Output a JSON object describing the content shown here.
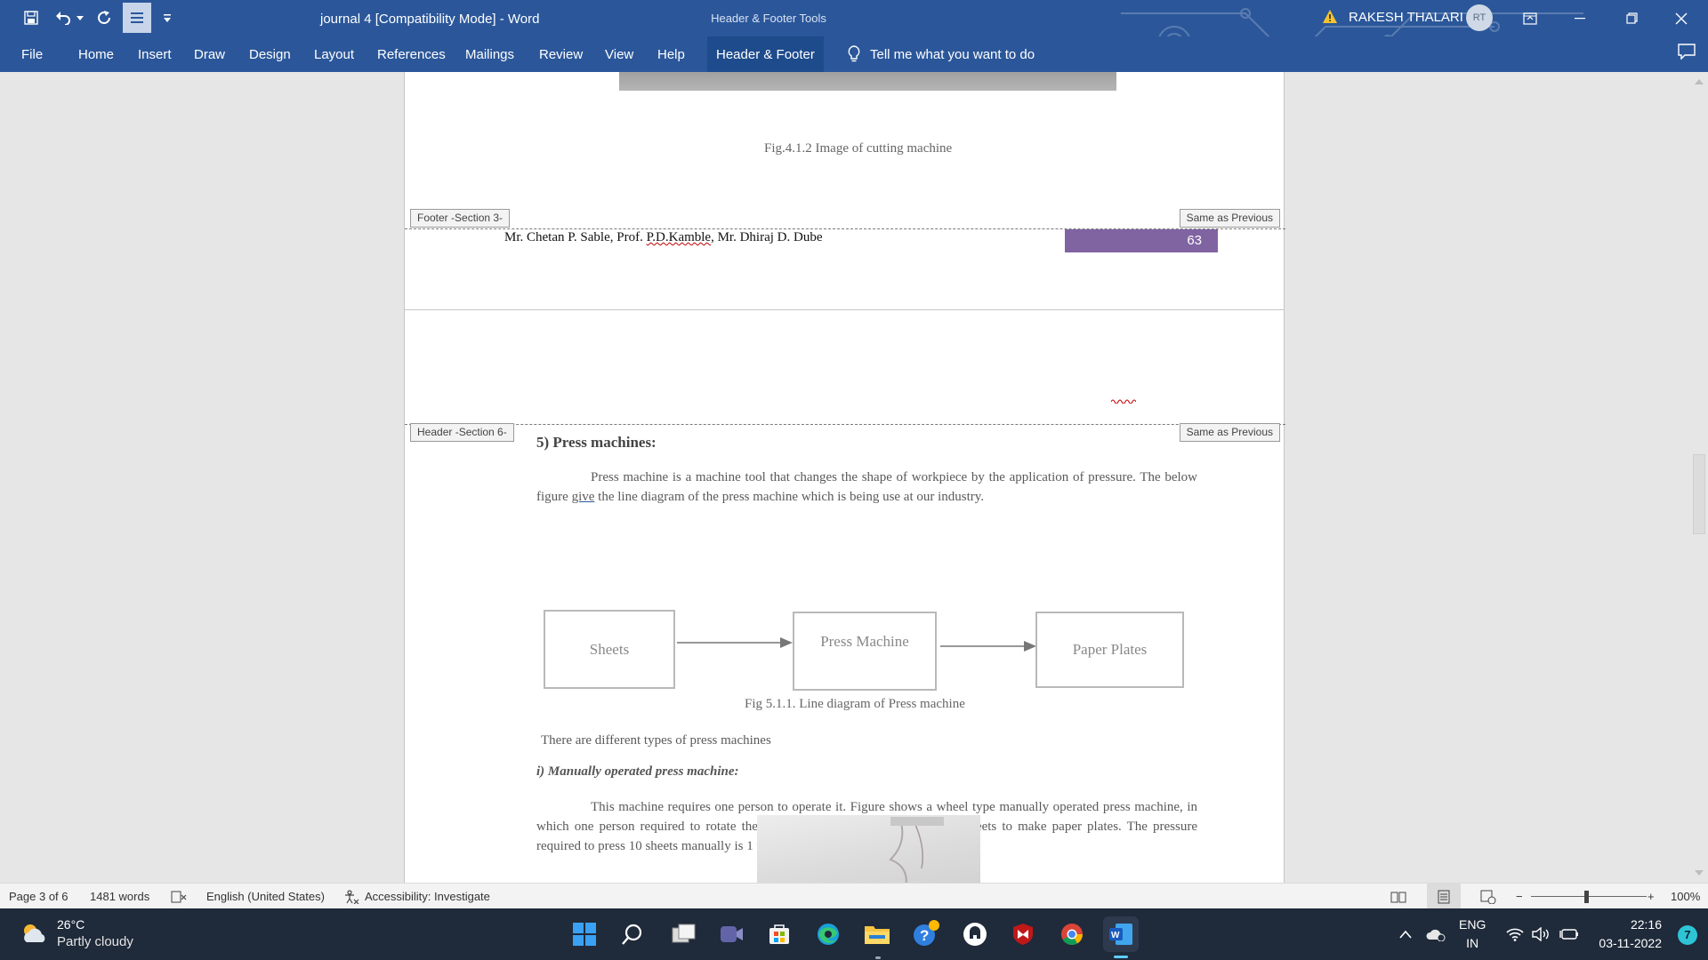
{
  "app": {
    "window_title": "journal 4 [Compatibility Mode]  -  Word",
    "contextual_group": "Header & Footer Tools",
    "user_name": "RAKESH THALARI",
    "user_initials": "RT"
  },
  "ribbon": {
    "tabs": [
      "File",
      "Home",
      "Insert",
      "Draw",
      "Design",
      "Layout",
      "References",
      "Mailings",
      "Review",
      "View",
      "Help",
      "Header & Footer"
    ],
    "active_tab": "Header & Footer",
    "tell_me": "Tell me what you want to do"
  },
  "document": {
    "page1": {
      "figure_caption": "Fig.4.1.2 Image of cutting machine",
      "footer_tag": "Footer -Section 3-",
      "same_as_previous": "Same as Previous",
      "footer_authors_pre": "Mr. Chetan P. Sable, Prof. ",
      "footer_authors_squiggle": "P.D.Kamble",
      "footer_authors_post": ", Mr. Dhiraj D. Dube",
      "page_number": "63"
    },
    "page2": {
      "header_tag": "Header -Section 6-",
      "same_as_previous": "Same as Previous",
      "heading": "5) Press machines:",
      "para1_a": "Press machine is a machine tool that changes the shape of workpiece by the application of pressure. The below figure ",
      "para1_link": "give",
      "para1_b": " the line diagram of the press machine which is being use at our industry.",
      "diagram": {
        "box1": "Sheets",
        "box2": "Press Machine",
        "box3": "Paper Plates",
        "caption": "Fig 5.1.1. Line diagram of Press machine"
      },
      "types_line": "There are different types of press machines",
      "subheading": "i) Manually operated press machine:",
      "para2": "This machine requires one person to operate it. Figure shows a wheel type manually operated press machine, in which one person required to rotate the wheel for applying the pressure on sheets to make paper plates. The pressure required to press 10 sheets manually is 1 ton."
    }
  },
  "status_bar": {
    "page": "Page 3 of 6",
    "words": "1481 words",
    "language": "English (United States)",
    "accessibility": "Accessibility: Investigate",
    "zoom": "100%",
    "zoom_minus": "−",
    "zoom_plus": "+"
  },
  "taskbar": {
    "temperature": "26°C",
    "weather": "Partly cloudy",
    "lang_top": "ENG",
    "lang_bottom": "IN",
    "time": "22:16",
    "date": "03-11-2022",
    "notification_count": "7"
  },
  "colors": {
    "ribbon": "#2b579a",
    "page_number_bg": "#8064a2",
    "taskbar": "#1f2a3a"
  }
}
